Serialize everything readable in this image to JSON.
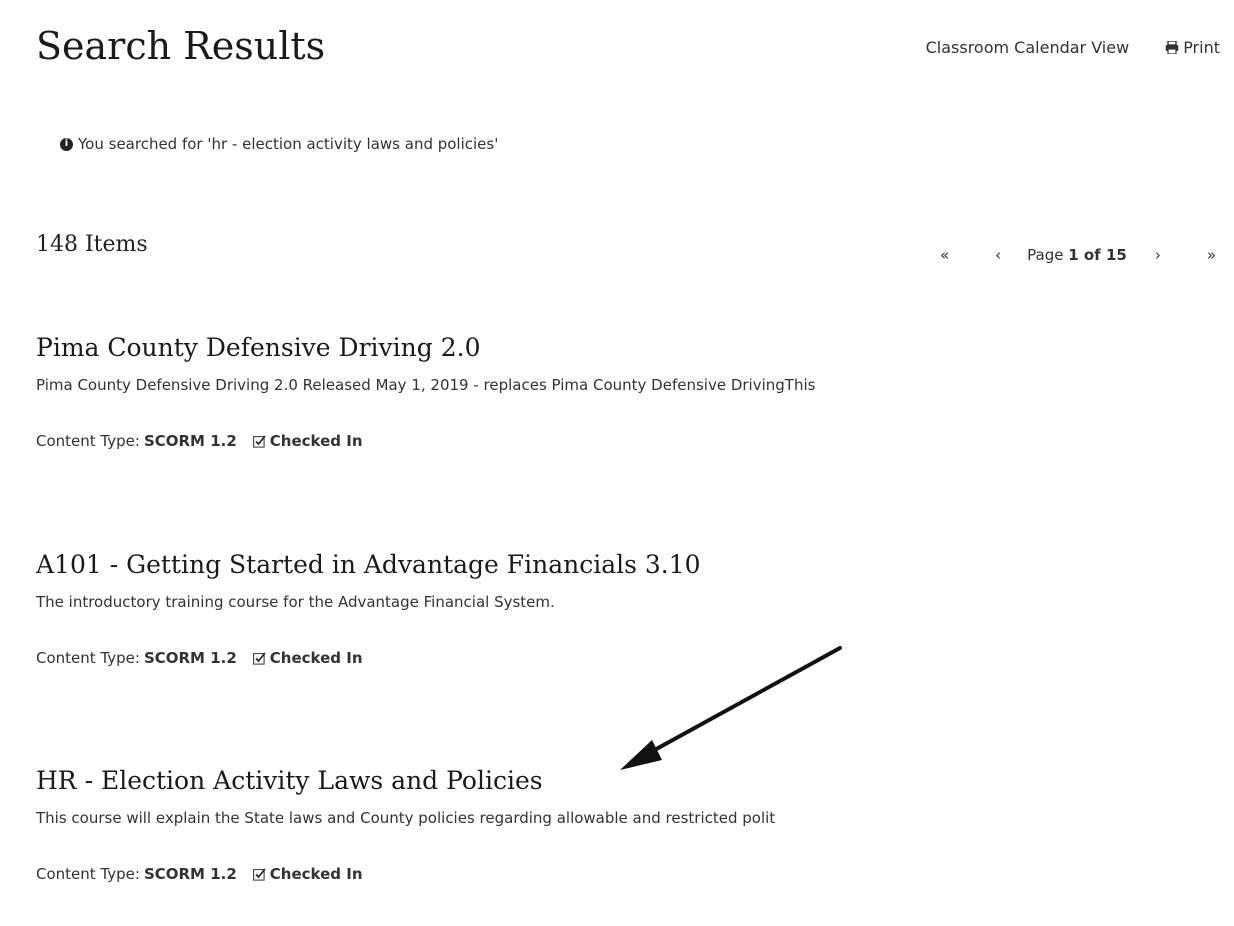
{
  "header": {
    "title": "Search Results",
    "calendar_link": "Classroom Calendar View",
    "print_link": "Print"
  },
  "search": {
    "note": "You searched for 'hr - election activity laws and policies'"
  },
  "items": {
    "count_label": "148 Items"
  },
  "pager": {
    "first": "«",
    "prev": "‹",
    "page_prefix": "Page ",
    "current": "1",
    "of_label": " of ",
    "total": "15",
    "next": "›",
    "last": "»"
  },
  "results": [
    {
      "title": "Pima County Defensive Driving 2.0",
      "description": "Pima County Defensive Driving 2.0 Released May 1, 2019 - replaces Pima County Defensive DrivingThis",
      "content_type_label": "Content Type:",
      "content_type": "SCORM 1.2",
      "status": "Checked In"
    },
    {
      "title": "A101 - Getting Started in Advantage Financials 3.10",
      "description": "The introductory training course for the Advantage Financial System.",
      "content_type_label": "Content Type:",
      "content_type": "SCORM 1.2",
      "status": "Checked In"
    },
    {
      "title": "HR - Election Activity Laws and Policies",
      "description": "This course will explain the State laws and County policies regarding allowable and restricted polit",
      "content_type_label": "Content Type:",
      "content_type": "SCORM 1.2",
      "status": "Checked In"
    }
  ],
  "icons": {
    "print": "printer-icon",
    "info": "info-icon",
    "check": "checkbox-check-icon",
    "annotation": "arrow-annotation"
  }
}
